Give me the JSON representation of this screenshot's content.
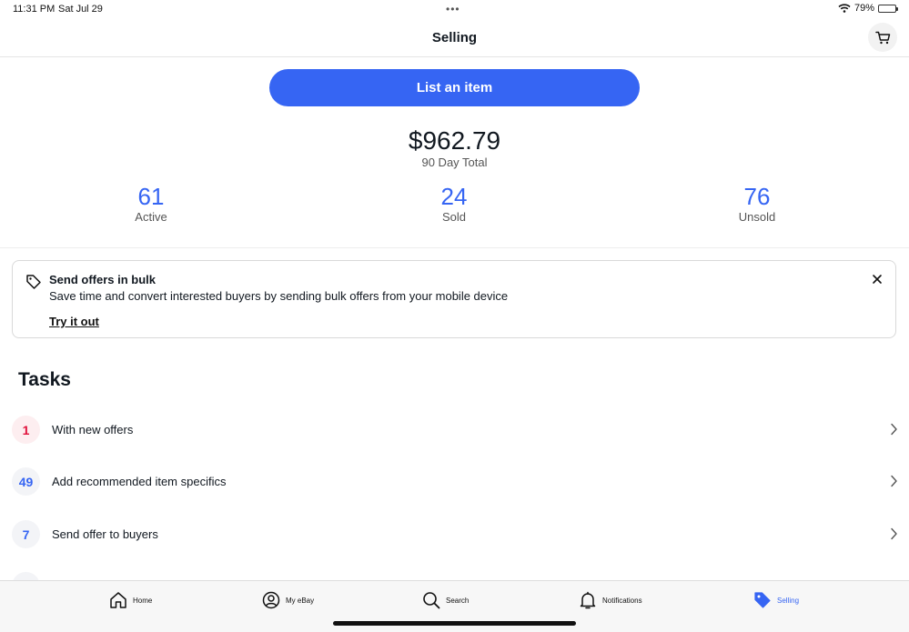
{
  "status": {
    "time": "11:31 PM",
    "date": "Sat Jul 29",
    "battery": "79%",
    "battery_level": 0.79
  },
  "header": {
    "title": "Selling",
    "cart_icon": "cart-icon"
  },
  "list_button_label": "List an item",
  "summary": {
    "amount": "$962.79",
    "label": "90 Day Total"
  },
  "stats": [
    {
      "value": "61",
      "label": "Active"
    },
    {
      "value": "24",
      "label": "Sold"
    },
    {
      "value": "76",
      "label": "Unsold"
    }
  ],
  "banner": {
    "icon": "tag-icon",
    "title": "Send offers in bulk",
    "description": "Save time and convert interested buyers by sending bulk offers from your mobile device",
    "link": "Try it out"
  },
  "tasks_title": "Tasks",
  "tasks": [
    {
      "count": "1",
      "label": "With new offers"
    },
    {
      "count": "49",
      "label": "Add recommended item specifics"
    },
    {
      "count": "7",
      "label": "Send offer to buyers"
    }
  ],
  "tabs": [
    {
      "label": "Home",
      "icon": "home-icon"
    },
    {
      "label": "My eBay",
      "icon": "profile-icon"
    },
    {
      "label": "Search",
      "icon": "search-icon"
    },
    {
      "label": "Notifications",
      "icon": "bell-icon"
    },
    {
      "label": "Selling",
      "icon": "tag-icon",
      "active": true
    }
  ],
  "colors": {
    "accent": "#3665f3",
    "alert": "#e0103a"
  }
}
